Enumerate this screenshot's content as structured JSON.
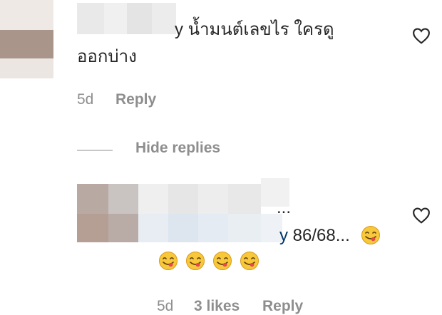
{
  "comment1": {
    "username_partial": "y",
    "text_line1": "น้ำมนต์เลขไร ใครดู",
    "text_line2": "ออกบ่าง",
    "time": "5d",
    "reply_label": "Reply"
  },
  "hide_replies_label": "Hide replies",
  "comment2": {
    "username_partial": "y",
    "ellipsis": "...",
    "text": "86/68...",
    "emoji_name": "face-savoring-food",
    "time": "5d",
    "likes": "3 likes",
    "reply_label": "Reply"
  },
  "colors": {
    "text_primary": "#262626",
    "text_secondary": "#8e8e8e",
    "mention": "#00376b",
    "emoji_yellow": "#f7c83a"
  },
  "icons": [
    "heart-outline-icon",
    "face-savoring-food-emoji"
  ]
}
